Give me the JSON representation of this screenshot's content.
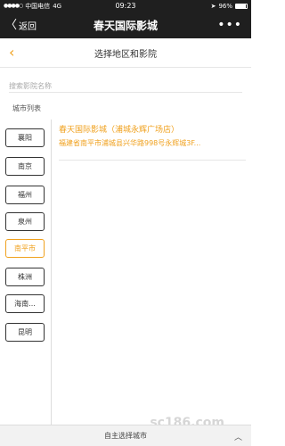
{
  "status": {
    "carrier": "中国电信",
    "network": "4G",
    "time": "09:23",
    "battery": "96%"
  },
  "nav": {
    "back_label": "返回",
    "title": "春天国际影城",
    "more": "•••"
  },
  "sub_header": {
    "title": "选择地区和影院"
  },
  "search": {
    "placeholder": "搜索影院名称"
  },
  "city_list_label": "城市列表",
  "cities": [
    {
      "name": "襄阳",
      "selected": false
    },
    {
      "name": "南京",
      "selected": false
    },
    {
      "name": "福州",
      "selected": false
    },
    {
      "name": "泉州",
      "selected": false
    },
    {
      "name": "南平市",
      "selected": true
    },
    {
      "name": "株洲",
      "selected": false
    },
    {
      "name": "海南...",
      "selected": false
    },
    {
      "name": "昆明",
      "selected": false
    }
  ],
  "cinemas": [
    {
      "name": "春天国际影城（浦城永辉广场店）",
      "address": "福建省南平市浦城县兴华路998号永辉城3F..."
    }
  ],
  "bottom_bar": {
    "label": "自主选择城市"
  },
  "watermark": "sc186.com",
  "colors": {
    "accent": "#f0a11e",
    "nav_bg": "#1f1f1f"
  }
}
